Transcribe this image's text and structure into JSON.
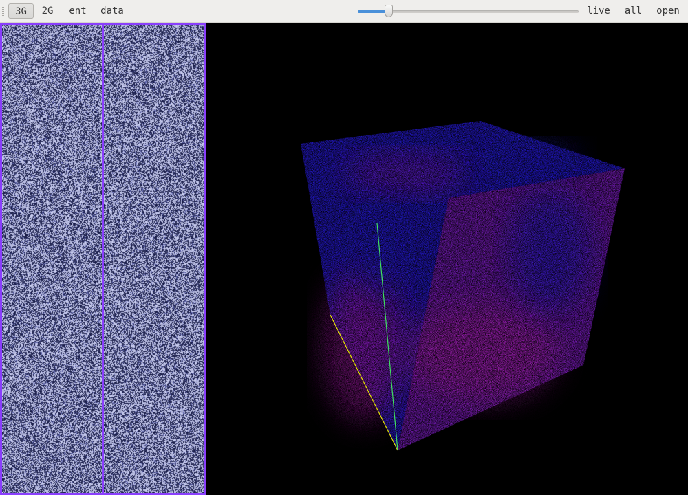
{
  "toolbar": {
    "modes": [
      {
        "label": "3G",
        "active": true
      },
      {
        "label": "2G",
        "active": false
      },
      {
        "label": "ent",
        "active": false
      },
      {
        "label": "data",
        "active": false
      }
    ],
    "slider": {
      "value": 0.14
    },
    "actions": [
      {
        "label": "live"
      },
      {
        "label": "all"
      },
      {
        "label": "open"
      }
    ]
  },
  "views": {
    "left_panel": {
      "border_color": "#8a3ffc",
      "noise_dark": "#1a1e4a",
      "noise_light": "#c8ccf0"
    },
    "right_panel": {
      "border_color": "#8a3ffc",
      "noise_dark": "#1a1e4a",
      "noise_light": "#c8ccf0"
    },
    "cube": {
      "colors": {
        "blue": "#2a1cf0",
        "purple": "#8a20d8",
        "magenta": "#c020c8"
      },
      "axes": {
        "x_color": "#e6e600",
        "y_color": "#40e060"
      }
    }
  }
}
